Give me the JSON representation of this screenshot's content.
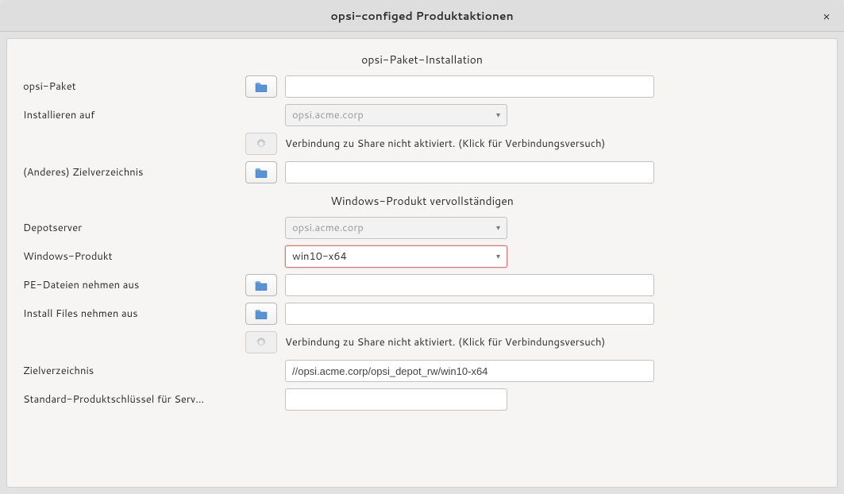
{
  "window": {
    "title": "opsi-configed Produktaktionen",
    "close_symbol": "×"
  },
  "section1": {
    "title": "opsi-Paket-Installation",
    "opsi_paket_label": "opsi-Paket",
    "opsi_paket_value": "",
    "install_on_label": "Installieren auf",
    "install_on_value": "opsi.acme.corp",
    "share_status": "Verbindung zu Share nicht aktiviert. (Klick für Verbindungsversuch)",
    "target_dir_label": "(Anderes) Zielverzeichnis",
    "target_dir_value": ""
  },
  "section2": {
    "title": "Windows-Produkt vervollständigen",
    "depot_label": "Depotserver",
    "depot_value": "opsi.acme.corp",
    "win_product_label": "Windows-Produkt",
    "win_product_value": "win10-x64",
    "pe_files_label": "PE-Dateien nehmen aus",
    "pe_files_value": "",
    "install_files_label": "Install Files nehmen aus",
    "install_files_value": "",
    "share_status": "Verbindung zu Share nicht aktiviert. (Klick für Verbindungsversuch)",
    "target_dir_label": "Zielverzeichnis",
    "target_dir_value": "//opsi.acme.corp/opsi_depot_rw/win10-x64",
    "product_key_label": "Standard-Produktschlüssel für Serv...",
    "product_key_value": ""
  }
}
